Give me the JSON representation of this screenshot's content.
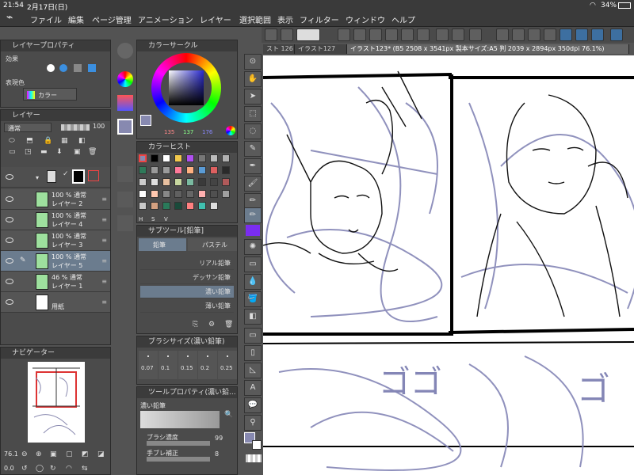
{
  "status_bar": {
    "time": "21:54",
    "date": "2月17日(日)",
    "battery": "34%"
  },
  "menubar": {
    "items": [
      "ファイル",
      "編集",
      "ページ管理",
      "アニメーション",
      "レイヤー",
      "選択範囲",
      "表示",
      "フィルター",
      "ウィンドウ",
      "ヘルプ"
    ]
  },
  "layer_property": {
    "title": "レイヤープロパティ",
    "effect_label": "効果",
    "expression_color_label": "表現色",
    "expression_color_value": "カラー"
  },
  "layer_panel": {
    "title": "レイヤー",
    "blend_mode": "通常",
    "opacity": "100",
    "folder_thumb_label": "",
    "layers": [
      {
        "line1": "100 % 通常",
        "line2": "レイヤー 2",
        "selected": false,
        "thumb": "green"
      },
      {
        "line1": "100 % 通常",
        "line2": "レイヤー 4",
        "selected": false,
        "thumb": "green"
      },
      {
        "line1": "100 % 通常",
        "line2": "レイヤー 3",
        "selected": false,
        "thumb": "green"
      },
      {
        "line1": "100 % 通常",
        "line2": "レイヤー 5",
        "selected": true,
        "thumb": "green"
      },
      {
        "line1": "46 % 通常",
        "line2": "レイヤー 1",
        "selected": false,
        "thumb": "green"
      },
      {
        "line1": "",
        "line2": "用紙",
        "selected": false,
        "thumb": "white"
      }
    ]
  },
  "navigator": {
    "title": "ナビゲーター",
    "zoom": "76.1",
    "rotation": "0.0"
  },
  "color_circle": {
    "title": "カラーサークル",
    "r": "135",
    "g": "137",
    "b": "176"
  },
  "color_history": {
    "title": "カラーヒスト",
    "mode_h": "H",
    "mode_s": "S",
    "mode_v": "V",
    "colors": [
      "#8a8ab0",
      "#000000",
      "#ffffff",
      "#f2c94c",
      "#b04ff0",
      "#777777",
      "#bbbbbb",
      "#b0b0b0",
      "#2f7a5a",
      "#999999",
      "#9b9b9b",
      "#ff7a9a",
      "#ffb080",
      "#5a9bd5",
      "#dd6060",
      "#2a2a2a",
      "#cccccc",
      "#e0e0e0",
      "#e8c0a0",
      "#c8d8a0",
      "#7abaa0",
      "#3a3a3a",
      "#444444",
      "#b05a5a",
      "#ffffff",
      "#ffc8b0",
      "#888888",
      "#606060",
      "#666666",
      "#ffb0b0",
      "#505050",
      "#a0a0a0",
      "#c8c8c8",
      "#d4a080",
      "#2a7a5a",
      "#1a4a3a",
      "#ff8080",
      "#40c0b0",
      "#dddddd"
    ]
  },
  "sub_tool": {
    "title": "サブツール[鉛筆]",
    "tab_pencil": "鉛筆",
    "tab_pastel": "パステル",
    "items": [
      {
        "label": "リアル鉛筆",
        "selected": false
      },
      {
        "label": "デッサン鉛筆",
        "selected": false
      },
      {
        "label": "濃い鉛筆",
        "selected": true
      },
      {
        "label": "薄い鉛筆",
        "selected": false
      }
    ]
  },
  "brush_size": {
    "title": "ブラシサイズ(濃い鉛筆)",
    "sizes": [
      "0.07",
      "0.1",
      "0.15",
      "0.2",
      "0.25"
    ]
  },
  "tool_property": {
    "title": "ツールプロパティ(濃い鉛...",
    "tool_name": "濃い鉛筆",
    "brush_density_label": "ブラシ濃度",
    "brush_density_value": "99",
    "stabilization_label": "手ブレ補正",
    "stabilization_value": "8"
  },
  "document_tabs": [
    {
      "label": "スト 126",
      "selected": false
    },
    {
      "label": "イラスト127",
      "selected": false
    },
    {
      "label": "イラスト123* (B5 2508 x 3541px 製本サイズ:A5 判 2039 x 2894px 350dpi 76.1%)",
      "selected": true
    }
  ],
  "colors": {
    "accent": "#6b7c8e",
    "panel_bg": "#4b4b4b",
    "menubar_bg": "#3a3a3a",
    "current_color": "#8789b0",
    "selected_swatch": "#8a8ab0"
  }
}
